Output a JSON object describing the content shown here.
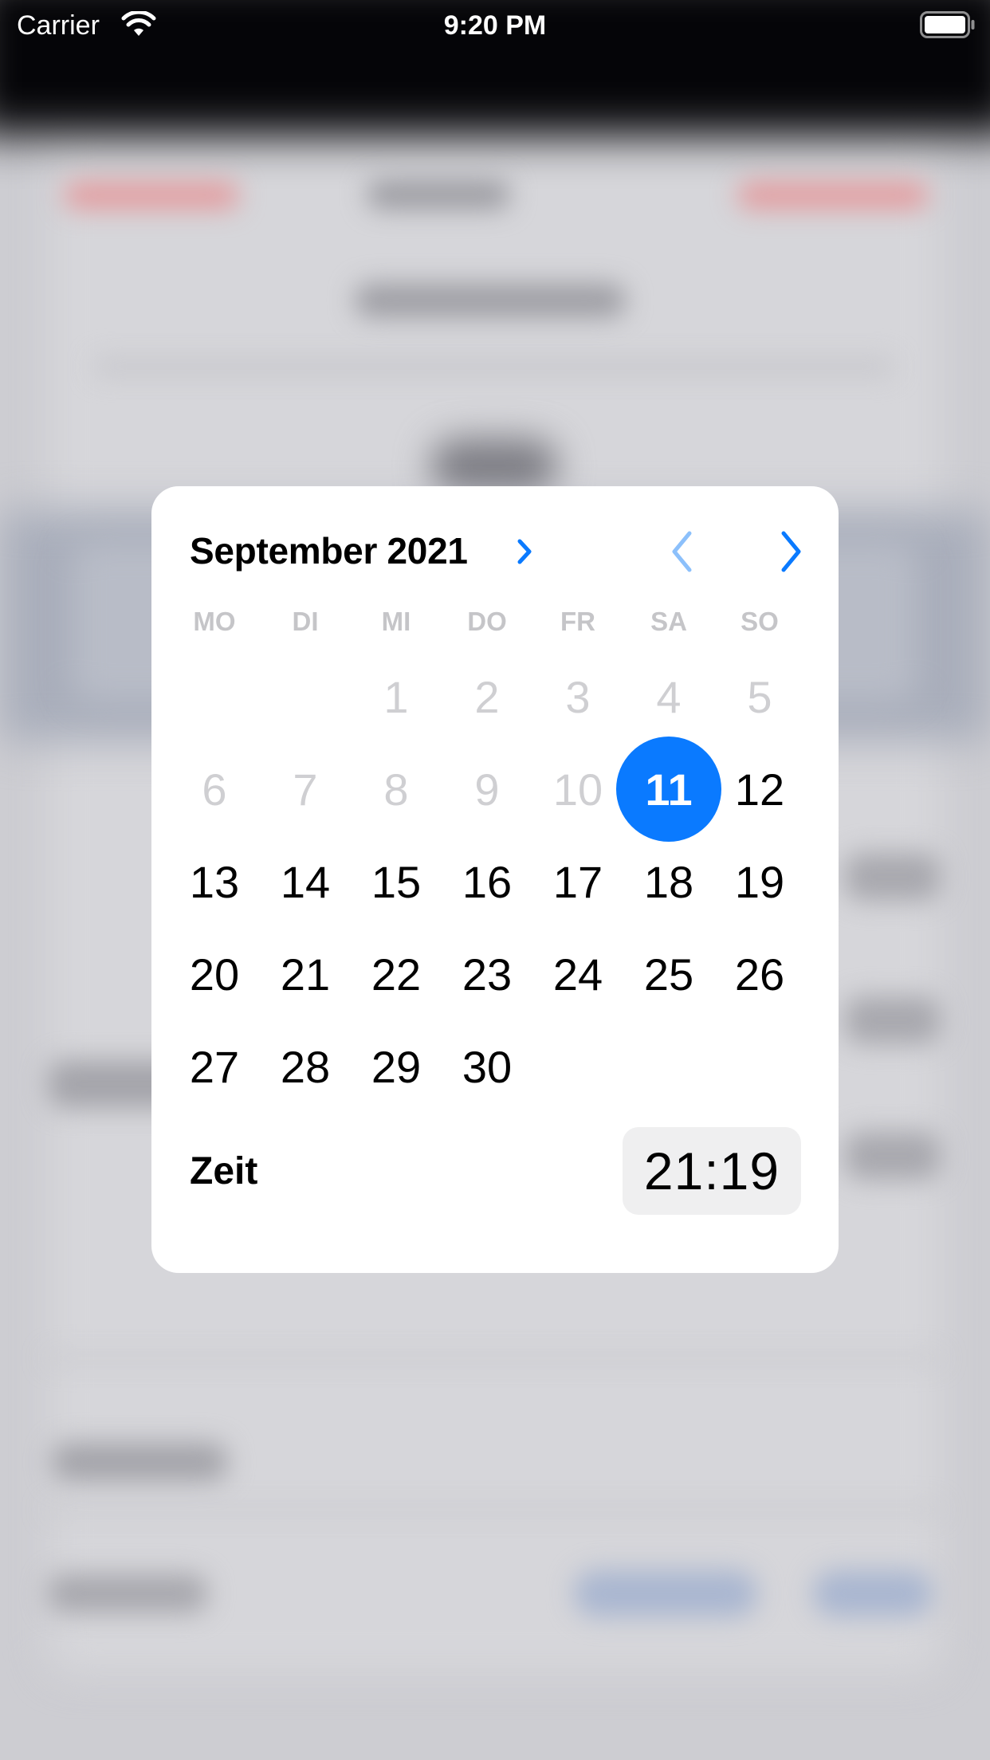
{
  "status_bar": {
    "carrier": "Carrier",
    "time": "9:20 PM",
    "icons": [
      "wifi-icon",
      "battery-icon"
    ]
  },
  "picker": {
    "month_label": "September 2021",
    "weekdays": [
      "MO",
      "DI",
      "MI",
      "DO",
      "FR",
      "SA",
      "SO"
    ],
    "leading_empty_days": 2,
    "days": [
      {
        "label": "1",
        "state": "past"
      },
      {
        "label": "2",
        "state": "past"
      },
      {
        "label": "3",
        "state": "past"
      },
      {
        "label": "4",
        "state": "past"
      },
      {
        "label": "5",
        "state": "past"
      },
      {
        "label": "6",
        "state": "past"
      },
      {
        "label": "7",
        "state": "past"
      },
      {
        "label": "8",
        "state": "past"
      },
      {
        "label": "9",
        "state": "past"
      },
      {
        "label": "10",
        "state": "past"
      },
      {
        "label": "11",
        "state": "selected"
      },
      {
        "label": "12",
        "state": "normal"
      },
      {
        "label": "13",
        "state": "normal"
      },
      {
        "label": "14",
        "state": "normal"
      },
      {
        "label": "15",
        "state": "normal"
      },
      {
        "label": "16",
        "state": "normal"
      },
      {
        "label": "17",
        "state": "normal"
      },
      {
        "label": "18",
        "state": "normal"
      },
      {
        "label": "19",
        "state": "normal"
      },
      {
        "label": "20",
        "state": "normal"
      },
      {
        "label": "21",
        "state": "normal"
      },
      {
        "label": "22",
        "state": "normal"
      },
      {
        "label": "23",
        "state": "normal"
      },
      {
        "label": "24",
        "state": "normal"
      },
      {
        "label": "25",
        "state": "normal"
      },
      {
        "label": "26",
        "state": "normal"
      },
      {
        "label": "27",
        "state": "normal"
      },
      {
        "label": "28",
        "state": "normal"
      },
      {
        "label": "29",
        "state": "normal"
      },
      {
        "label": "30",
        "state": "normal"
      }
    ],
    "time_label": "Zeit",
    "time_value": "21:19",
    "colors": {
      "accent": "#0a7aff",
      "accent_disabled": "#8cc0fb",
      "weekday_text": "#c5c5c8",
      "past_day_text": "#cfcfd2",
      "time_field_bg": "#efeff0"
    },
    "icons": {
      "month_toggle": "chevron-right-icon",
      "previous_month": "chevron-left-icon",
      "next_month": "chevron-right-icon"
    }
  }
}
